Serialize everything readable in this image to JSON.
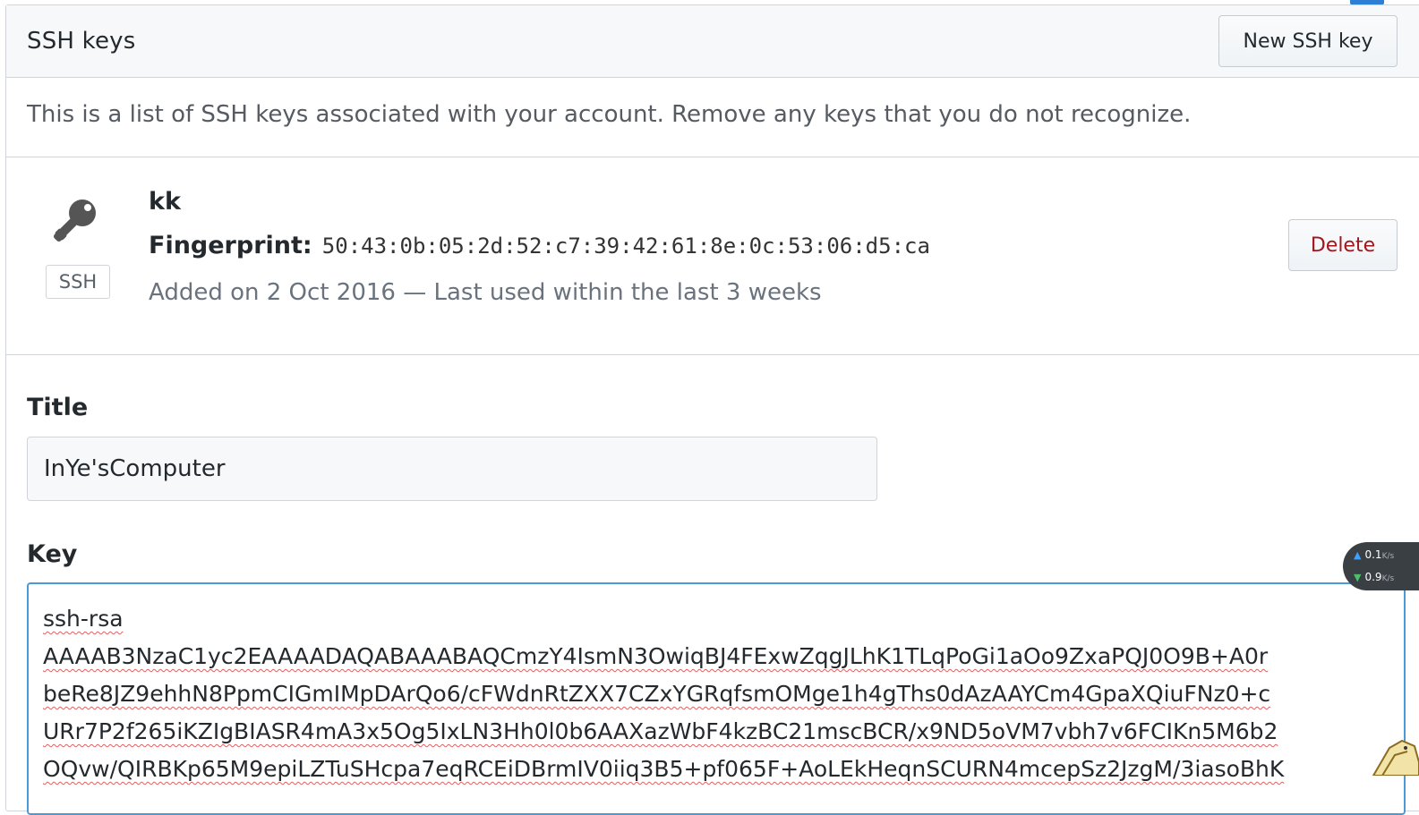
{
  "panel": {
    "title": "SSH keys",
    "new_key_button": "New SSH key",
    "intro": "This is a list of SSH keys associated with your account. Remove any keys that you do not recognize."
  },
  "ssh_key": {
    "icon": "key-icon",
    "badge": "SSH",
    "name": "kk",
    "fingerprint_label": "Fingerprint:",
    "fingerprint": "50:43:0b:05:2d:52:c7:39:42:61:8e:0c:53:06:d5:ca",
    "added": "Added on 2 Oct 2016 — Last used within the last 3 weeks",
    "delete_button": "Delete"
  },
  "form": {
    "title_label": "Title",
    "title_value": "InYe'sComputer",
    "key_label": "Key",
    "key_value": "ssh-rsa\nAAAAB3NzaC1yc2EAAAADAQABAAABAQCmzY4IsmN3OwiqBJ4FExwZqgJLhK1TLqPoGi1aOo9ZxaPQJ0O9B+A0r\nbeRe8JZ9ehhN8PpmCIGmIMpDArQo6/cFWdnRtZXX7CZxYGRqfsmOMge1h4gThs0dAzAAYCm4GpaXQiuFNz0+c\nURr7P2f265iKZIgBIASR4mA3x5Og5IxLN3Hh0l0b6AAXazWbF4kzBC21mscBCR/x9ND5oVM7vbh7v6FCIKn5M6b2\nOQvw/QIRBKp65M9epiLZTuSHcpa7eqRCEiDBrmIV0iiq3B5+pf065F+AoLEkHeqnSCURN4mcepSz2JzgM/3iasoBhK"
  },
  "network_widget": {
    "upload": "0.1",
    "download": "0.9",
    "unit": "K/s",
    "colors": {
      "up": "#3fa0ff",
      "down": "#4bc06a"
    }
  },
  "colors": {
    "accent": "#4a9ad9",
    "delete": "#a0171d",
    "border": "#d1d5da",
    "header_bg": "#f6f8fa"
  }
}
